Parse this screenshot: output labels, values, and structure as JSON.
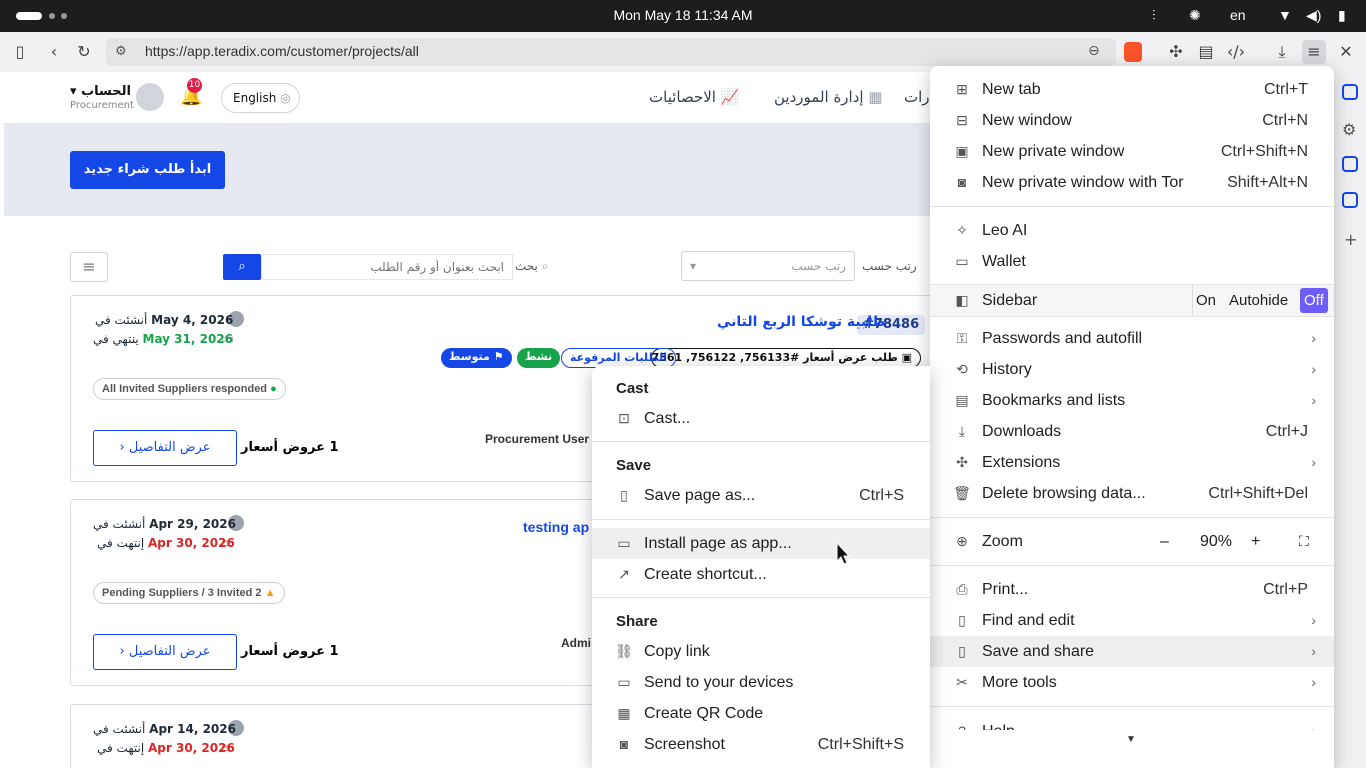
{
  "os": {
    "clock": "Mon May 18  11:34 AM",
    "lang": "en"
  },
  "browser": {
    "url": "https://app.teradix.com/customer/projects/all"
  },
  "nav": {
    "account_label": "الحساب",
    "account_sub": "Procurement",
    "notif_count": "10",
    "lang_button": "English",
    "stats": "الاحصائيات",
    "suppliers": "إدارة الموردين",
    "partial": "درات"
  },
  "banner": {
    "new_request": "ابدأ طلب شراء جديد"
  },
  "filters": {
    "search_label": "بحث",
    "search_placeholder": "ابحث بعنوان أو رقم الطلب",
    "sort_label": "رتب حسب",
    "sort_placeholder": "رتب حسب"
  },
  "cards": [
    {
      "id": "#78486",
      "title": "طلبية توشكا الربع التاني",
      "created_label": "أنشئت في",
      "created": "May 4, 2026",
      "ends_label": "ينتهي في",
      "ends": "May 31, 2026",
      "rfq": "طلب عرض أسعار  #756133, 756122, 7561...",
      "tag_uploaded": "الطلبات المرفوعة",
      "tag_active": "نشط",
      "tag_priority": "متوسط",
      "status": "All Invited Suppliers responded",
      "offers": "1 عروض أسعار",
      "details": "عرض التفاصيل",
      "user": "Procurement User"
    },
    {
      "title": "testing ap",
      "created_label": "أنشئت في",
      "created": "Apr 29, 2026",
      "ends_label": "إنتهت في",
      "ends": "Apr 30, 2026",
      "status": "Pending Suppliers / 3 Invited 2",
      "offers": "1 عروض أسعار",
      "details": "عرض التفاصيل",
      "user": "Admi"
    },
    {
      "created_label": "أنشئت في",
      "created": "Apr 14, 2026",
      "ends_label": "إنتهت في",
      "ends": "Apr 30, 2026"
    }
  ],
  "main_menu": {
    "new_tab": "New tab",
    "new_tab_sc": "Ctrl+T",
    "new_window": "New window",
    "new_window_sc": "Ctrl+N",
    "new_private": "New private window",
    "new_private_sc": "Ctrl+Shift+N",
    "new_tor": "New private window with Tor",
    "new_tor_sc": "Shift+Alt+N",
    "leo": "Leo AI",
    "wallet": "Wallet",
    "sidebar": "Sidebar",
    "sb_on": "On",
    "sb_autohide": "Autohide",
    "sb_off": "Off",
    "passwords": "Passwords and autofill",
    "history": "History",
    "bookmarks": "Bookmarks and lists",
    "downloads": "Downloads",
    "downloads_sc": "Ctrl+J",
    "extensions": "Extensions",
    "delete": "Delete browsing data...",
    "delete_sc": "Ctrl+Shift+Del",
    "zoom": "Zoom",
    "zoom_minus": "–",
    "zoom_value": "90%",
    "zoom_plus": "+",
    "print": "Print...",
    "print_sc": "Ctrl+P",
    "find": "Find and edit",
    "save_share": "Save and share",
    "more_tools": "More tools",
    "help": "Help"
  },
  "sub_menu": {
    "cast_hdr": "Cast",
    "cast": "Cast...",
    "save_hdr": "Save",
    "save_page": "Save page as...",
    "save_page_sc": "Ctrl+S",
    "install": "Install page as app...",
    "shortcut": "Create shortcut...",
    "share_hdr": "Share",
    "copy_link": "Copy link",
    "send": "Send to your devices",
    "qr": "Create QR Code",
    "screenshot": "Screenshot",
    "screenshot_sc": "Ctrl+Shift+S"
  },
  "colors": {
    "primary": "#1447e6",
    "active_green": "#16a34a",
    "ended_red": "#dc2626",
    "menu_highlight": "#6d5efc"
  }
}
